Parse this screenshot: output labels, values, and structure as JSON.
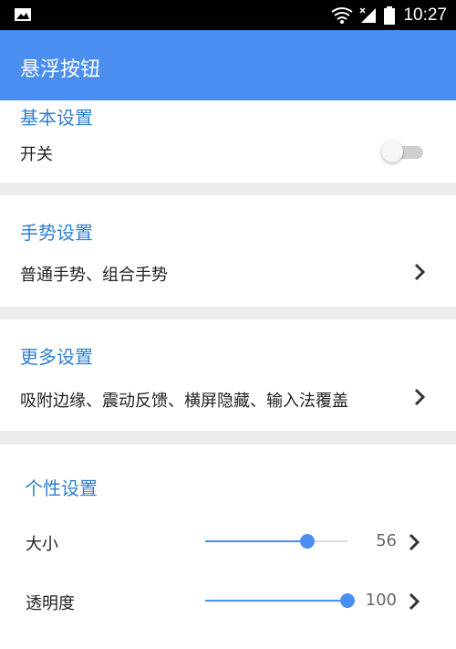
{
  "status_bar": {
    "left_icon": "image-notification-icon",
    "right_icons": [
      "wifi-icon",
      "signal-icon",
      "battery-icon"
    ],
    "time": "10:27"
  },
  "app_bar": {
    "title": "悬浮按钮",
    "background_color": "#4a8ef0"
  },
  "sections": {
    "basic": {
      "title": "基本设置",
      "switch_label": "开关",
      "switch_on": false
    },
    "gesture": {
      "title": "手势设置",
      "summary": "普通手势、组合手势"
    },
    "more": {
      "title": "更多设置",
      "summary": "吸附边缘、震动反馈、横屏隐藏、输入法覆盖"
    },
    "personal": {
      "title": "个性设置",
      "size_label": "大小",
      "size_value": "56",
      "size_fraction": 0.72,
      "opacity_label": "透明度",
      "opacity_value": "100",
      "opacity_fraction": 1.0
    }
  },
  "colors": {
    "accent": "#4a8ef0",
    "section_title": "#2f7fd1",
    "page_bg": "#ececec"
  }
}
